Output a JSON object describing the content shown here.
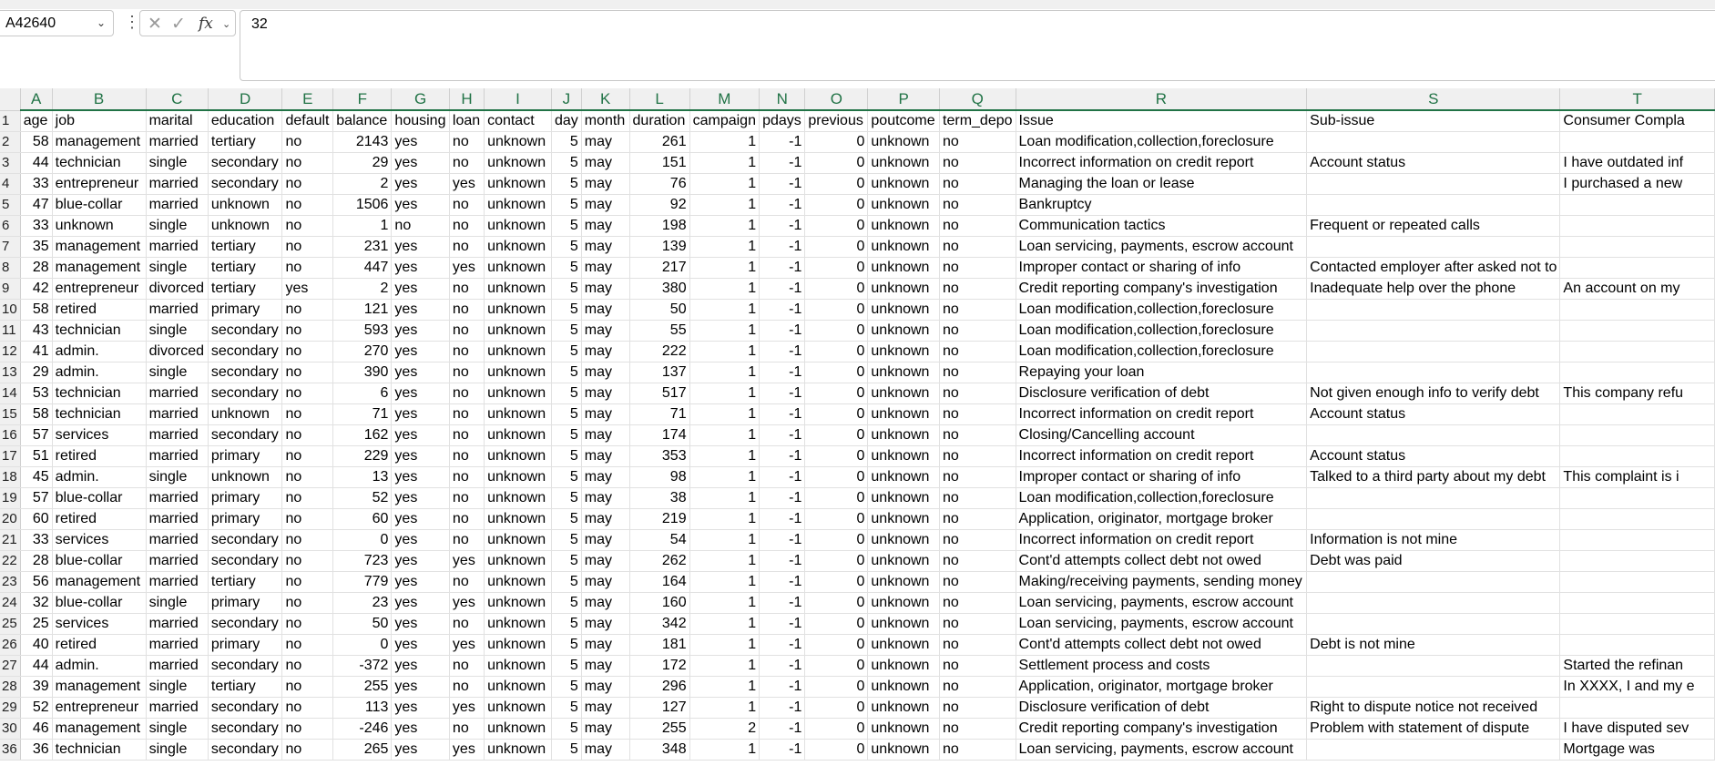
{
  "formula_bar": {
    "name_box": "A42640",
    "formula_value": "32"
  },
  "columns": [
    "A",
    "B",
    "C",
    "D",
    "E",
    "F",
    "G",
    "H",
    "I",
    "J",
    "K",
    "L",
    "M",
    "N",
    "O",
    "P",
    "Q",
    "R",
    "S",
    "T"
  ],
  "row_numbers": [
    "1",
    "2",
    "3",
    "4",
    "5",
    "6",
    "7",
    "8",
    "9",
    "10",
    "11",
    "12",
    "13",
    "14",
    "15",
    "16",
    "17",
    "18",
    "19",
    "20",
    "21",
    "22",
    "23",
    "24",
    "25",
    "26",
    "27",
    "28",
    "29",
    "30",
    "36"
  ],
  "rows": [
    [
      "age",
      "job",
      "marital",
      "education",
      "default",
      "balance",
      "housing",
      "loan",
      "contact",
      "day",
      "month",
      "duration",
      "campaign",
      "pdays",
      "previous",
      "poutcome",
      "term_depo",
      "Issue",
      "Sub-issue",
      "Consumer Compla"
    ],
    [
      "58",
      "management",
      "married",
      "tertiary",
      "no",
      "2143",
      "yes",
      "no",
      "unknown",
      "5",
      "may",
      "261",
      "1",
      "-1",
      "0",
      "unknown",
      "no",
      "Loan modification,collection,foreclosure",
      "",
      ""
    ],
    [
      "44",
      "technician",
      "single",
      "secondary",
      "no",
      "29",
      "yes",
      "no",
      "unknown",
      "5",
      "may",
      "151",
      "1",
      "-1",
      "0",
      "unknown",
      "no",
      "Incorrect information on credit report",
      "Account status",
      "I have outdated inf"
    ],
    [
      "33",
      "entrepreneur",
      "married",
      "secondary",
      "no",
      "2",
      "yes",
      "yes",
      "unknown",
      "5",
      "may",
      "76",
      "1",
      "-1",
      "0",
      "unknown",
      "no",
      "Managing the loan or lease",
      "",
      "I purchased a new"
    ],
    [
      "47",
      "blue-collar",
      "married",
      "unknown",
      "no",
      "1506",
      "yes",
      "no",
      "unknown",
      "5",
      "may",
      "92",
      "1",
      "-1",
      "0",
      "unknown",
      "no",
      "Bankruptcy",
      "",
      ""
    ],
    [
      "33",
      "unknown",
      "single",
      "unknown",
      "no",
      "1",
      "no",
      "no",
      "unknown",
      "5",
      "may",
      "198",
      "1",
      "-1",
      "0",
      "unknown",
      "no",
      "Communication tactics",
      "Frequent or repeated calls",
      ""
    ],
    [
      "35",
      "management",
      "married",
      "tertiary",
      "no",
      "231",
      "yes",
      "no",
      "unknown",
      "5",
      "may",
      "139",
      "1",
      "-1",
      "0",
      "unknown",
      "no",
      "Loan servicing, payments, escrow account",
      "",
      ""
    ],
    [
      "28",
      "management",
      "single",
      "tertiary",
      "no",
      "447",
      "yes",
      "yes",
      "unknown",
      "5",
      "may",
      "217",
      "1",
      "-1",
      "0",
      "unknown",
      "no",
      "Improper contact or sharing of info",
      "Contacted employer after asked not to",
      ""
    ],
    [
      "42",
      "entrepreneur",
      "divorced",
      "tertiary",
      "yes",
      "2",
      "yes",
      "no",
      "unknown",
      "5",
      "may",
      "380",
      "1",
      "-1",
      "0",
      "unknown",
      "no",
      "Credit reporting company's investigation",
      "Inadequate help over the phone",
      "An account on my"
    ],
    [
      "58",
      "retired",
      "married",
      "primary",
      "no",
      "121",
      "yes",
      "no",
      "unknown",
      "5",
      "may",
      "50",
      "1",
      "-1",
      "0",
      "unknown",
      "no",
      "Loan modification,collection,foreclosure",
      "",
      ""
    ],
    [
      "43",
      "technician",
      "single",
      "secondary",
      "no",
      "593",
      "yes",
      "no",
      "unknown",
      "5",
      "may",
      "55",
      "1",
      "-1",
      "0",
      "unknown",
      "no",
      "Loan modification,collection,foreclosure",
      "",
      ""
    ],
    [
      "41",
      "admin.",
      "divorced",
      "secondary",
      "no",
      "270",
      "yes",
      "no",
      "unknown",
      "5",
      "may",
      "222",
      "1",
      "-1",
      "0",
      "unknown",
      "no",
      "Loan modification,collection,foreclosure",
      "",
      ""
    ],
    [
      "29",
      "admin.",
      "single",
      "secondary",
      "no",
      "390",
      "yes",
      "no",
      "unknown",
      "5",
      "may",
      "137",
      "1",
      "-1",
      "0",
      "unknown",
      "no",
      "Repaying your loan",
      "",
      ""
    ],
    [
      "53",
      "technician",
      "married",
      "secondary",
      "no",
      "6",
      "yes",
      "no",
      "unknown",
      "5",
      "may",
      "517",
      "1",
      "-1",
      "0",
      "unknown",
      "no",
      "Disclosure verification of debt",
      "Not given enough info to verify debt",
      "This company refu"
    ],
    [
      "58",
      "technician",
      "married",
      "unknown",
      "no",
      "71",
      "yes",
      "no",
      "unknown",
      "5",
      "may",
      "71",
      "1",
      "-1",
      "0",
      "unknown",
      "no",
      "Incorrect information on credit report",
      "Account status",
      ""
    ],
    [
      "57",
      "services",
      "married",
      "secondary",
      "no",
      "162",
      "yes",
      "no",
      "unknown",
      "5",
      "may",
      "174",
      "1",
      "-1",
      "0",
      "unknown",
      "no",
      "Closing/Cancelling account",
      "",
      ""
    ],
    [
      "51",
      "retired",
      "married",
      "primary",
      "no",
      "229",
      "yes",
      "no",
      "unknown",
      "5",
      "may",
      "353",
      "1",
      "-1",
      "0",
      "unknown",
      "no",
      "Incorrect information on credit report",
      "Account status",
      ""
    ],
    [
      "45",
      "admin.",
      "single",
      "unknown",
      "no",
      "13",
      "yes",
      "no",
      "unknown",
      "5",
      "may",
      "98",
      "1",
      "-1",
      "0",
      "unknown",
      "no",
      "Improper contact or sharing of info",
      "Talked to a third party about my debt",
      "This complaint is i"
    ],
    [
      "57",
      "blue-collar",
      "married",
      "primary",
      "no",
      "52",
      "yes",
      "no",
      "unknown",
      "5",
      "may",
      "38",
      "1",
      "-1",
      "0",
      "unknown",
      "no",
      "Loan modification,collection,foreclosure",
      "",
      ""
    ],
    [
      "60",
      "retired",
      "married",
      "primary",
      "no",
      "60",
      "yes",
      "no",
      "unknown",
      "5",
      "may",
      "219",
      "1",
      "-1",
      "0",
      "unknown",
      "no",
      "Application, originator, mortgage broker",
      "",
      ""
    ],
    [
      "33",
      "services",
      "married",
      "secondary",
      "no",
      "0",
      "yes",
      "no",
      "unknown",
      "5",
      "may",
      "54",
      "1",
      "-1",
      "0",
      "unknown",
      "no",
      "Incorrect information on credit report",
      "Information is not mine",
      ""
    ],
    [
      "28",
      "blue-collar",
      "married",
      "secondary",
      "no",
      "723",
      "yes",
      "yes",
      "unknown",
      "5",
      "may",
      "262",
      "1",
      "-1",
      "0",
      "unknown",
      "no",
      "Cont'd attempts collect debt not owed",
      "Debt was paid",
      ""
    ],
    [
      "56",
      "management",
      "married",
      "tertiary",
      "no",
      "779",
      "yes",
      "no",
      "unknown",
      "5",
      "may",
      "164",
      "1",
      "-1",
      "0",
      "unknown",
      "no",
      "Making/receiving payments, sending money",
      "",
      ""
    ],
    [
      "32",
      "blue-collar",
      "single",
      "primary",
      "no",
      "23",
      "yes",
      "yes",
      "unknown",
      "5",
      "may",
      "160",
      "1",
      "-1",
      "0",
      "unknown",
      "no",
      "Loan servicing, payments, escrow account",
      "",
      ""
    ],
    [
      "25",
      "services",
      "married",
      "secondary",
      "no",
      "50",
      "yes",
      "no",
      "unknown",
      "5",
      "may",
      "342",
      "1",
      "-1",
      "0",
      "unknown",
      "no",
      "Loan servicing, payments, escrow account",
      "",
      ""
    ],
    [
      "40",
      "retired",
      "married",
      "primary",
      "no",
      "0",
      "yes",
      "yes",
      "unknown",
      "5",
      "may",
      "181",
      "1",
      "-1",
      "0",
      "unknown",
      "no",
      "Cont'd attempts collect debt not owed",
      "Debt is not mine",
      ""
    ],
    [
      "44",
      "admin.",
      "married",
      "secondary",
      "no",
      "-372",
      "yes",
      "no",
      "unknown",
      "5",
      "may",
      "172",
      "1",
      "-1",
      "0",
      "unknown",
      "no",
      "Settlement process and costs",
      "",
      "Started the refinan"
    ],
    [
      "39",
      "management",
      "single",
      "tertiary",
      "no",
      "255",
      "yes",
      "no",
      "unknown",
      "5",
      "may",
      "296",
      "1",
      "-1",
      "0",
      "unknown",
      "no",
      "Application, originator, mortgage broker",
      "",
      "In XXXX, I and my e"
    ],
    [
      "52",
      "entrepreneur",
      "married",
      "secondary",
      "no",
      "113",
      "yes",
      "yes",
      "unknown",
      "5",
      "may",
      "127",
      "1",
      "-1",
      "0",
      "unknown",
      "no",
      "Disclosure verification of debt",
      "Right to dispute notice not received",
      ""
    ],
    [
      "46",
      "management",
      "single",
      "secondary",
      "no",
      "-246",
      "yes",
      "no",
      "unknown",
      "5",
      "may",
      "255",
      "2",
      "-1",
      "0",
      "unknown",
      "no",
      "Credit reporting company's investigation",
      "Problem with statement of dispute",
      "I have disputed sev"
    ],
    [
      "36",
      "technician",
      "single",
      "secondary",
      "no",
      "265",
      "yes",
      "yes",
      "unknown",
      "5",
      "may",
      "348",
      "1",
      "-1",
      "0",
      "unknown",
      "no",
      "Loan servicing, payments, escrow account",
      "",
      "Mortgage was"
    ]
  ]
}
